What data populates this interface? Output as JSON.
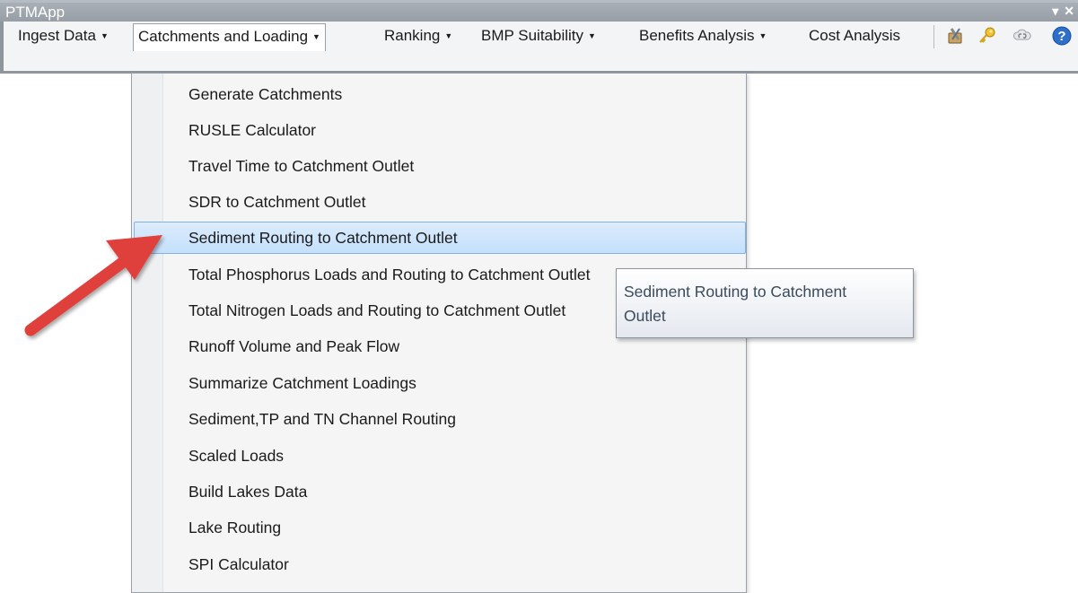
{
  "window": {
    "title": "PTMApp",
    "controls": [
      "▾",
      "✕"
    ]
  },
  "toolbar": {
    "menus": [
      {
        "label": "Ingest Data"
      },
      {
        "label": "Catchments and Loading"
      },
      {
        "label": "Ranking"
      },
      {
        "label": "BMP Suitability"
      },
      {
        "label": "Benefits Analysis"
      },
      {
        "label": "Cost Analysis"
      }
    ],
    "icons": [
      "tools-icon",
      "key-icon",
      "cloud-link-icon",
      "help-icon"
    ]
  },
  "dropdown": {
    "items": [
      {
        "label": "Generate Catchments"
      },
      {
        "label": "RUSLE Calculator"
      },
      {
        "label": "Travel Time to Catchment Outlet"
      },
      {
        "label": "SDR to Catchment Outlet"
      },
      {
        "label": "Sediment Routing to Catchment Outlet"
      },
      {
        "label": "Total Phosphorus Loads and Routing to Catchment Outlet"
      },
      {
        "label": "Total Nitrogen Loads and Routing to Catchment Outlet"
      },
      {
        "label": "Runoff Volume and Peak Flow"
      },
      {
        "label": "Summarize Catchment Loadings"
      },
      {
        "label": "Sediment,TP and TN Channel Routing"
      },
      {
        "label": "Scaled Loads"
      },
      {
        "label": "Build Lakes Data"
      },
      {
        "label": "Lake Routing"
      },
      {
        "label": "SPI Calculator"
      }
    ],
    "hovered": "Sediment Routing to Catchment Outlet"
  },
  "tooltip": {
    "line1": "Sediment Routing to Catchment",
    "line2": "Outlet"
  },
  "annotation": {
    "arrow_color": "#e0403a"
  }
}
